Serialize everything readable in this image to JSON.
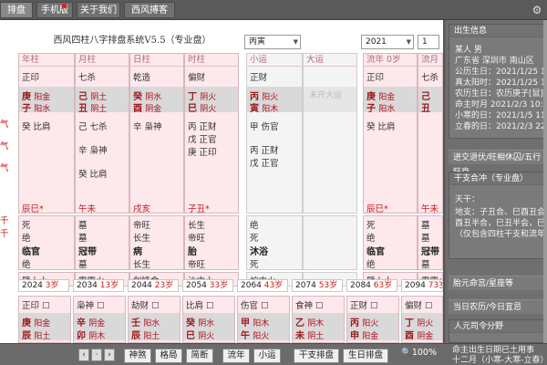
{
  "tabs": [
    "排盘",
    "手机版",
    "关于我们",
    "西风搏客"
  ],
  "icons": {
    "settings": "gear-icon",
    "search": "magnifier-icon"
  },
  "title": "西风四柱八字排盘系统V5.5（专业盘）",
  "selects": {
    "period": "丙寅",
    "year": "2021",
    "num": "1"
  },
  "columns": {
    "year": {
      "header": "年柱",
      "shishen": "正印",
      "gan": "庚",
      "gan_wx": "阳金",
      "zhi": "子",
      "zhi_wx": "阳水",
      "canggan": [
        "癸  比肩"
      ],
      "kongwang": "辰巳*",
      "dishi": "死",
      "xing": "绝",
      "xing2": "临官",
      "xing3": "绝",
      "nayin": "壁上土"
    },
    "month": {
      "header": "月柱",
      "shishen": "七杀",
      "gan": "己",
      "gan_wx": "阴土",
      "zhi": "丑",
      "zhi_wx": "阴土",
      "canggan": [
        "己  七杀",
        "辛  枭神",
        "癸  比肩"
      ],
      "kongwang": "午未",
      "dishi": "墓",
      "xing": "墓",
      "xing2": "冠带",
      "xing3": "墓",
      "nayin": "霹雳火"
    },
    "day": {
      "header": "日柱",
      "shishen": "乾造",
      "gan": "癸",
      "gan_wx": "阴水",
      "zhi": "酉",
      "zhi_wx": "阴金",
      "canggan": [
        "辛  枭神"
      ],
      "kongwang": "戌亥",
      "dishi": "帝旺",
      "xing": "长生",
      "xing2": "病",
      "xing3": "长生",
      "nayin": "剑锋金"
    },
    "hour": {
      "header": "时柱",
      "shishen": "偏财",
      "gan": "丁",
      "gan_wx": "阴火",
      "zhi": "巳",
      "zhi_wx": "阴火",
      "canggan": [
        "丙  正财",
        "戊  正官",
        "庚  正印"
      ],
      "kongwang": "子丑*",
      "dishi": "长生",
      "xing": "帝旺",
      "xing2": "胎",
      "xing3": "帝旺",
      "nayin": "沙中土"
    }
  },
  "yun": {
    "xiaoyun": {
      "header": "小运",
      "shishen": "正财",
      "gan": "丙",
      "gan_wx": "阳火",
      "zhi": "寅",
      "zhi_wx": "阳木",
      "canggan": [
        "甲  伤官",
        "丙  正财",
        "戊  正官"
      ],
      "dishi": "绝",
      "xing": "死",
      "xing2": "沐浴",
      "xing3": "死",
      "nayin": "炉中火"
    },
    "dayun": {
      "header": "大运",
      "ghost": "未开大运"
    },
    "liunian": {
      "header": "流年 0岁",
      "shishen": "正印",
      "gan": "庚",
      "gan_wx": "阳金",
      "zhi": "子",
      "zhi_wx": "阳水",
      "canggan": [
        "癸  比肩"
      ],
      "kongwang": "辰巳*",
      "dishi": "死",
      "xing": "绝",
      "xing2": "临官",
      "xing3": "绝",
      "nayin": "壁上土"
    },
    "liuyue": {
      "header": "流月",
      "shishen": "七杀",
      "gan": "己",
      "zhi": "丑",
      "kongwang": "午未",
      "dishi": "墓",
      "xing": "墓",
      "xing2": "冠带",
      "xing3": "墓",
      "nayin": "霹雳火"
    }
  },
  "dayun_years": [
    {
      "year": "2024",
      "age": "3岁"
    },
    {
      "year": "2034",
      "age": "13岁"
    },
    {
      "year": "2044",
      "age": "23岁"
    },
    {
      "year": "2054",
      "age": "33岁"
    },
    {
      "year": "2064",
      "age": "43岁"
    },
    {
      "year": "2074",
      "age": "53岁"
    },
    {
      "year": "2084",
      "age": "63岁"
    },
    {
      "year": "2094",
      "age": "73岁"
    }
  ],
  "dayun_cols": [
    {
      "shishen": "正印",
      "gan": "庚",
      "gan_wx": "阳金",
      "zhi": "辰",
      "zhi_wx": "阳土"
    },
    {
      "shishen": "枭神",
      "gan": "辛",
      "gan_wx": "阴金",
      "zhi": "卯",
      "zhi_wx": "阴木"
    },
    {
      "shishen": "劫财",
      "gan": "壬",
      "gan_wx": "阳水",
      "zhi": "辰",
      "zhi_wx": "阳土"
    },
    {
      "shishen": "比肩",
      "gan": "癸",
      "gan_wx": "阴水",
      "zhi": "巳",
      "zhi_wx": "阴火"
    },
    {
      "shishen": "伤官",
      "gan": "甲",
      "gan_wx": "阳木",
      "zhi": "午",
      "zhi_wx": "阳火"
    },
    {
      "shishen": "食神",
      "gan": "乙",
      "gan_wx": "阴木",
      "zhi": "未",
      "zhi_wx": "阴土"
    },
    {
      "shishen": "正财",
      "gan": "丙",
      "gan_wx": "阳火",
      "zhi": "申",
      "zhi_wx": "阳金"
    },
    {
      "shishen": "偏财",
      "gan": "丁",
      "gan_wx": "阴火",
      "zhi": "酉",
      "zhi_wx": "阴金"
    }
  ],
  "left_edge": [
    "气",
    "气",
    "气",
    "千",
    "千"
  ],
  "bottom_buttons": [
    "神煞",
    "格局",
    "简断",
    "流年",
    "小运",
    "干支排盘",
    "生日排盘"
  ],
  "zoom": "100%",
  "sidebar": {
    "info_header": "出生信息",
    "info_lines": [
      "某人  男",
      "广东省 深圳市 南山区",
      "公历生日：2021/1/25 11:00",
      "真太阳时：2021/1/25 10:44",
      "农历生日：农历庚子[鼠]年十二月",
      "命主时月 2021/2/3 10:16",
      "小寒的日：2021/1/5 11:23",
      "立春的日：2021/2/3 22:58"
    ],
    "btn1": "进交退伏/旺相休囚/五行旺衰",
    "ganzhi_header": "干支合冲（专业盘）",
    "ganzhi_lines": [
      "天干：",
      "地支：子丑合、巳酉丑会金",
      "酉丑半合，巳丑半会，巳酉丑会",
      "（仅包含四柱干支和流年干支）"
    ],
    "btn2": "胎元命宫/星座等",
    "btn3": "当日农历/今日宜忌",
    "renyuan_header": "人元司令分野",
    "renyuan_lines": [
      "命主出生日期已土用事",
      "十二月（小寒-大寒-立春）"
    ]
  }
}
